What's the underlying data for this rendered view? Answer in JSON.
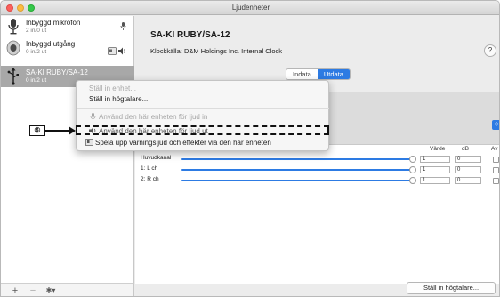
{
  "window": {
    "title": "Ljudenheter"
  },
  "sidebar": {
    "devices": [
      {
        "name": "Inbyggd mikrofon",
        "sub": "2 in/0 ut",
        "icon": "microphone-icon",
        "selected": false
      },
      {
        "name": "Inbyggd utgång",
        "sub": "0 in/2 ut",
        "icon": "speaker-icon",
        "selected": false
      },
      {
        "name": "SA-KI RUBY/SA-12",
        "sub": "0 in/2 ut",
        "icon": "usb-icon",
        "selected": true
      }
    ],
    "bottom": {
      "add": "+",
      "remove": "−",
      "gear": "✱▾"
    }
  },
  "device": {
    "title": "SA-KI RUBY/SA-12",
    "clock_label": "Klockkälla:",
    "clock_value": "D&M Holdings Inc. Internal Clock",
    "help": "?"
  },
  "tabs": [
    {
      "label": "Indata",
      "active": false
    },
    {
      "label": "Utdata",
      "active": true
    }
  ],
  "table": {
    "headers": {
      "value": "Värde",
      "db": "dB",
      "mute": "Av"
    },
    "rows": [
      {
        "label": "Huvudkanal",
        "value": "1",
        "db": "0"
      },
      {
        "label": "1: L ch",
        "value": "1",
        "db": "0"
      },
      {
        "label": "2: R ch",
        "value": "1",
        "db": "0"
      }
    ]
  },
  "footer": {
    "speaker_button": "Ställ in högtalare..."
  },
  "context_menu": {
    "items": [
      {
        "label": "Ställ in enhet...",
        "enabled": false
      },
      {
        "label": "Ställ in högtalare...",
        "enabled": true
      },
      {
        "label": "Använd den här enheten för ljud in",
        "enabled": false,
        "icon": "microphone-icon"
      },
      {
        "label": "Använd den här enheten för ljud ut",
        "enabled": true,
        "icon": "speaker-icon"
      },
      {
        "label": "Spela upp varningsljud och effekter via den här enheten",
        "enabled": true,
        "icon": "finder-icon"
      }
    ]
  },
  "callout": {
    "number": "⑥"
  },
  "colors": {
    "accent": "#2d7be3",
    "selection": "#a8a8a8"
  }
}
